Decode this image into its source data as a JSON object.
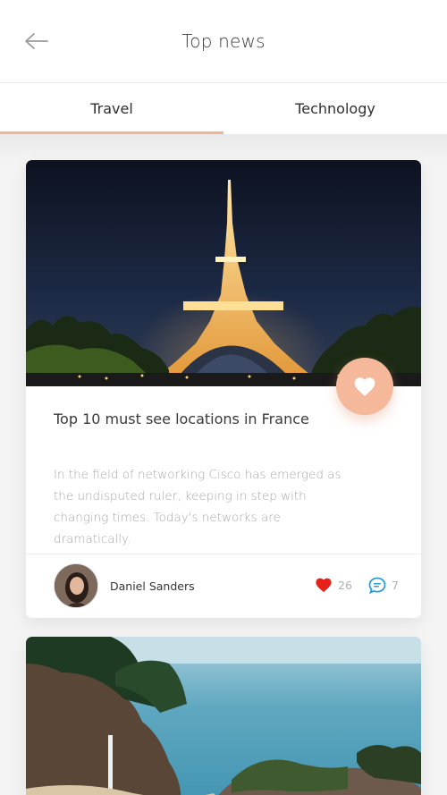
{
  "header": {
    "title": "Top news",
    "back_icon": "arrow-left-icon"
  },
  "tabs": [
    {
      "label": "Travel",
      "active": true
    },
    {
      "label": "Technology",
      "active": false
    }
  ],
  "colors": {
    "accent": "#f2b394",
    "fav_button": "#f5b89b",
    "like_heart": "#e8201a",
    "comment_icon": "#2a9fd6"
  },
  "cards": [
    {
      "image": "eiffel-tower-night-photo",
      "title": "Top 10 must see locations in France",
      "description": "In the field of networking Cisco has emerged as the undisputed ruler, keeping in step with changing times. Today's networks are dramatically.",
      "author": "Daniel Sanders",
      "likes": "26",
      "comments": "7",
      "fav_icon": "heart-icon"
    },
    {
      "image": "coastal-waterfall-photo"
    }
  ]
}
